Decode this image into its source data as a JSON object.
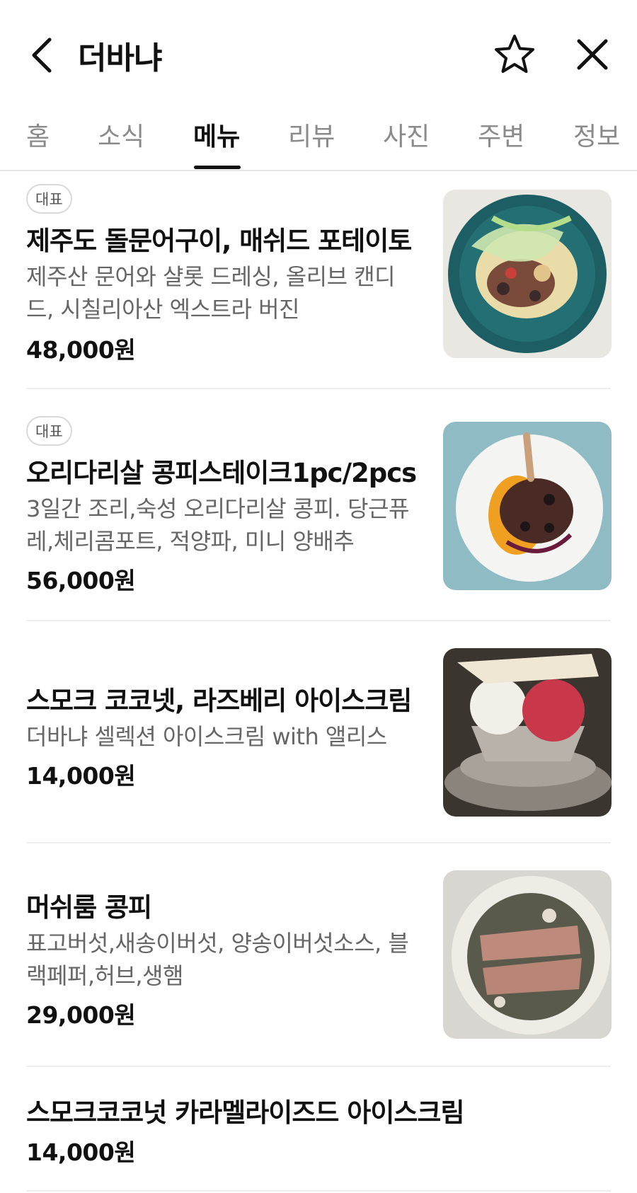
{
  "header": {
    "title": "더바냐",
    "back_icon": "chevron-left-icon",
    "favorite_icon": "star-outline-icon",
    "close_icon": "close-icon"
  },
  "tabs": [
    {
      "label": "홈",
      "active": false
    },
    {
      "label": "소식",
      "active": false
    },
    {
      "label": "메뉴",
      "active": true
    },
    {
      "label": "리뷰",
      "active": false
    },
    {
      "label": "사진",
      "active": false
    },
    {
      "label": "주변",
      "active": false
    },
    {
      "label": "정보",
      "active": false
    }
  ],
  "menu": {
    "items": [
      {
        "badge": "대표",
        "name": "제주도 돌문어구이, 매쉬드 포테이토",
        "desc1": "제주산 문어와 샬롯 드레싱, 올리브 캔디",
        "desc2": "드, 시칠리아산 엑스트라 버진",
        "price": "48,000원"
      },
      {
        "badge": "대표",
        "name": "오리다리살 콩피스테이크1pc/2pcs",
        "desc1": "3일간 조리,숙성 오리다리살 콩피. 당근퓨",
        "desc2": "레,체리콤포트, 적양파, 미니 양배추",
        "price": "56,000원"
      },
      {
        "name": "스모크 코코넷, 라즈베리 아이스크림",
        "desc1": "더바냐 셀렉션 아이스크림 with 앨리스",
        "price": "14,000원"
      },
      {
        "name": "머쉬룸 콩피",
        "desc1": "표고버섯,새송이버섯, 양송이버섯소스, 블",
        "desc2": "랙페퍼,허브,생햄",
        "price": "29,000원"
      },
      {
        "name": "스모크코코넛 카라멜라이즈드 아이스크림",
        "price": "14,000원"
      }
    ]
  },
  "colors": {
    "text_primary": "#111111",
    "text_secondary": "#666666",
    "tab_inactive": "#8a8a8a",
    "divider": "#eeeeee"
  }
}
